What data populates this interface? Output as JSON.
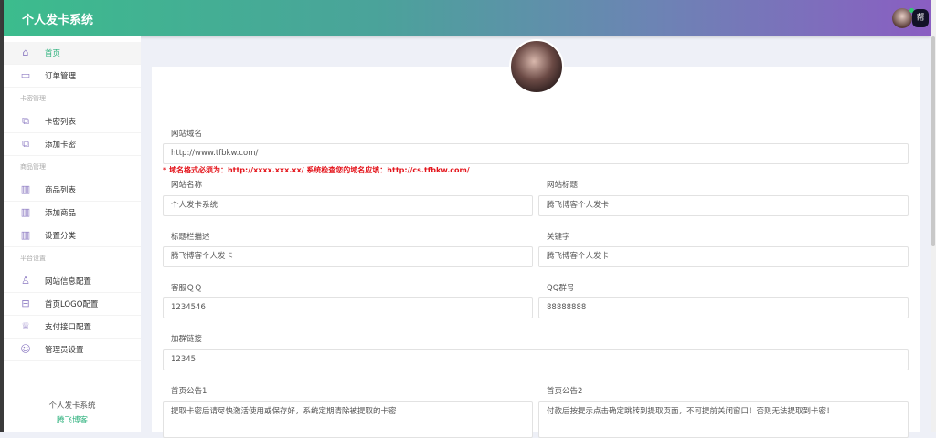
{
  "header": {
    "title": "个人发卡系统",
    "badge": "帮"
  },
  "sidebar": {
    "items": [
      {
        "label": "首页",
        "icon": "home-icon",
        "glyph": "⌂"
      },
      {
        "label": "订单管理",
        "icon": "clipboard-icon",
        "glyph": "▭"
      }
    ],
    "groups": [
      {
        "title": "卡密管理",
        "items": [
          {
            "label": "卡密列表",
            "glyph": "⧉"
          },
          {
            "label": "添加卡密",
            "glyph": "⧉"
          }
        ]
      },
      {
        "title": "商品管理",
        "items": [
          {
            "label": "商品列表",
            "glyph": "▥"
          },
          {
            "label": "添加商品",
            "glyph": "▥"
          },
          {
            "label": "设置分类",
            "glyph": "▥"
          }
        ]
      },
      {
        "title": "平台设置",
        "items": [
          {
            "label": "网站信息配置",
            "glyph": "♙"
          },
          {
            "label": "首页LOGO配置",
            "glyph": "⊟"
          },
          {
            "label": "支付接口配置",
            "glyph": "♕"
          },
          {
            "label": "管理员设置",
            "glyph": "☺"
          }
        ]
      }
    ],
    "footer": {
      "name": "个人发卡系统",
      "author": "腾飞博客"
    }
  },
  "form": {
    "domain_label": "网站域名",
    "domain_value": "http://www.tfbkw.com/",
    "note": "* 域名格式必须为：http://xxxx.xxx.xx/ 系统检查您的域名应填：http://cs.tfbkw.com/",
    "site_name_label": "网站名称",
    "site_name_value": "个人发卡系统",
    "site_title_label": "网站标题",
    "site_title_value": "腾飞博客个人发卡",
    "desc_label": "标题栏描述",
    "desc_value": "腾飞博客个人发卡",
    "keywords_label": "关键字",
    "keywords_value": "腾飞博客个人发卡",
    "qq_label": "客服ＱＱ",
    "qq_value": "1234546",
    "qqgroup_label": "QQ群号",
    "qqgroup_value": "88888888",
    "grouplink_label": "加群链接",
    "grouplink_value": "12345",
    "notice1_label": "首页公告1",
    "notice1_value": "提取卡密后请尽快激活使用或保存好，系统定期清除被提取的卡密",
    "notice2_label": "首页公告2",
    "notice2_value": "付款后按提示点击确定跳转到提取页面，不可提前关闭窗口！否则无法提取到卡密！"
  },
  "colors": {
    "accent": "#2fb27e",
    "error": "#e4141b"
  }
}
